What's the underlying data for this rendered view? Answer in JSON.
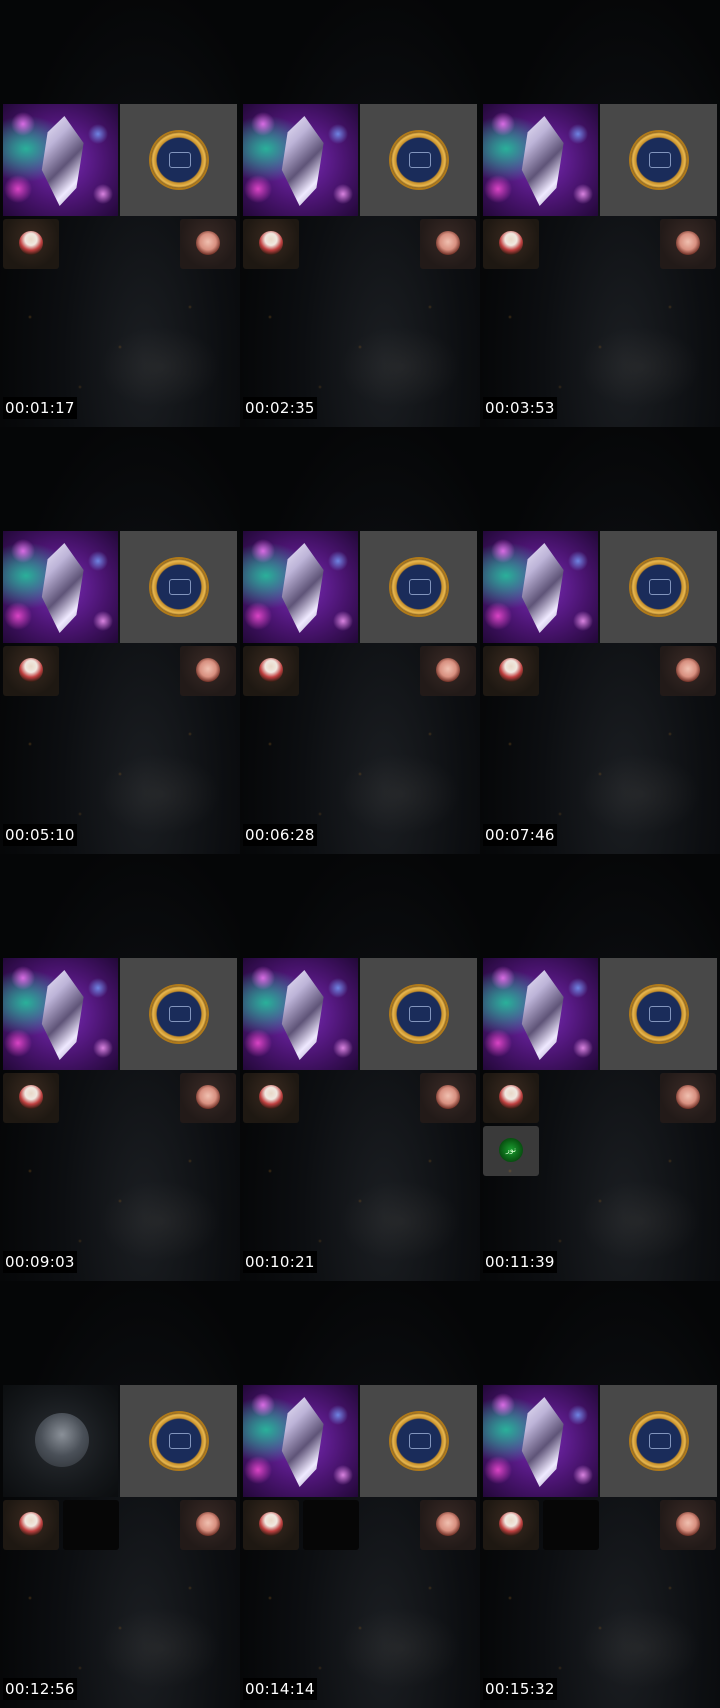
{
  "frames": [
    {
      "timestamp": "00:01:17",
      "main_tile": "crystal"
    },
    {
      "timestamp": "00:02:35",
      "main_tile": "crystal"
    },
    {
      "timestamp": "00:03:53",
      "main_tile": "crystal"
    },
    {
      "timestamp": "00:05:10",
      "main_tile": "crystal"
    },
    {
      "timestamp": "00:06:28",
      "main_tile": "crystal"
    },
    {
      "timestamp": "00:07:46",
      "main_tile": "crystal"
    },
    {
      "timestamp": "00:09:03",
      "main_tile": "crystal"
    },
    {
      "timestamp": "00:10:21",
      "main_tile": "crystal"
    },
    {
      "timestamp": "00:11:39",
      "main_tile": "crystal",
      "extra_tile_label": "نور"
    },
    {
      "timestamp": "00:12:56",
      "main_tile": "video"
    },
    {
      "timestamp": "00:14:14",
      "main_tile": "crystal"
    },
    {
      "timestamp": "00:15:32",
      "main_tile": "crystal"
    }
  ],
  "colors": {
    "background": "#000000",
    "logo_tile": "#484848",
    "timestamp_text": "#ffffff"
  },
  "icons": [
    "crystal-image",
    "emblem-logo",
    "avatar-man",
    "avatar-woman"
  ]
}
